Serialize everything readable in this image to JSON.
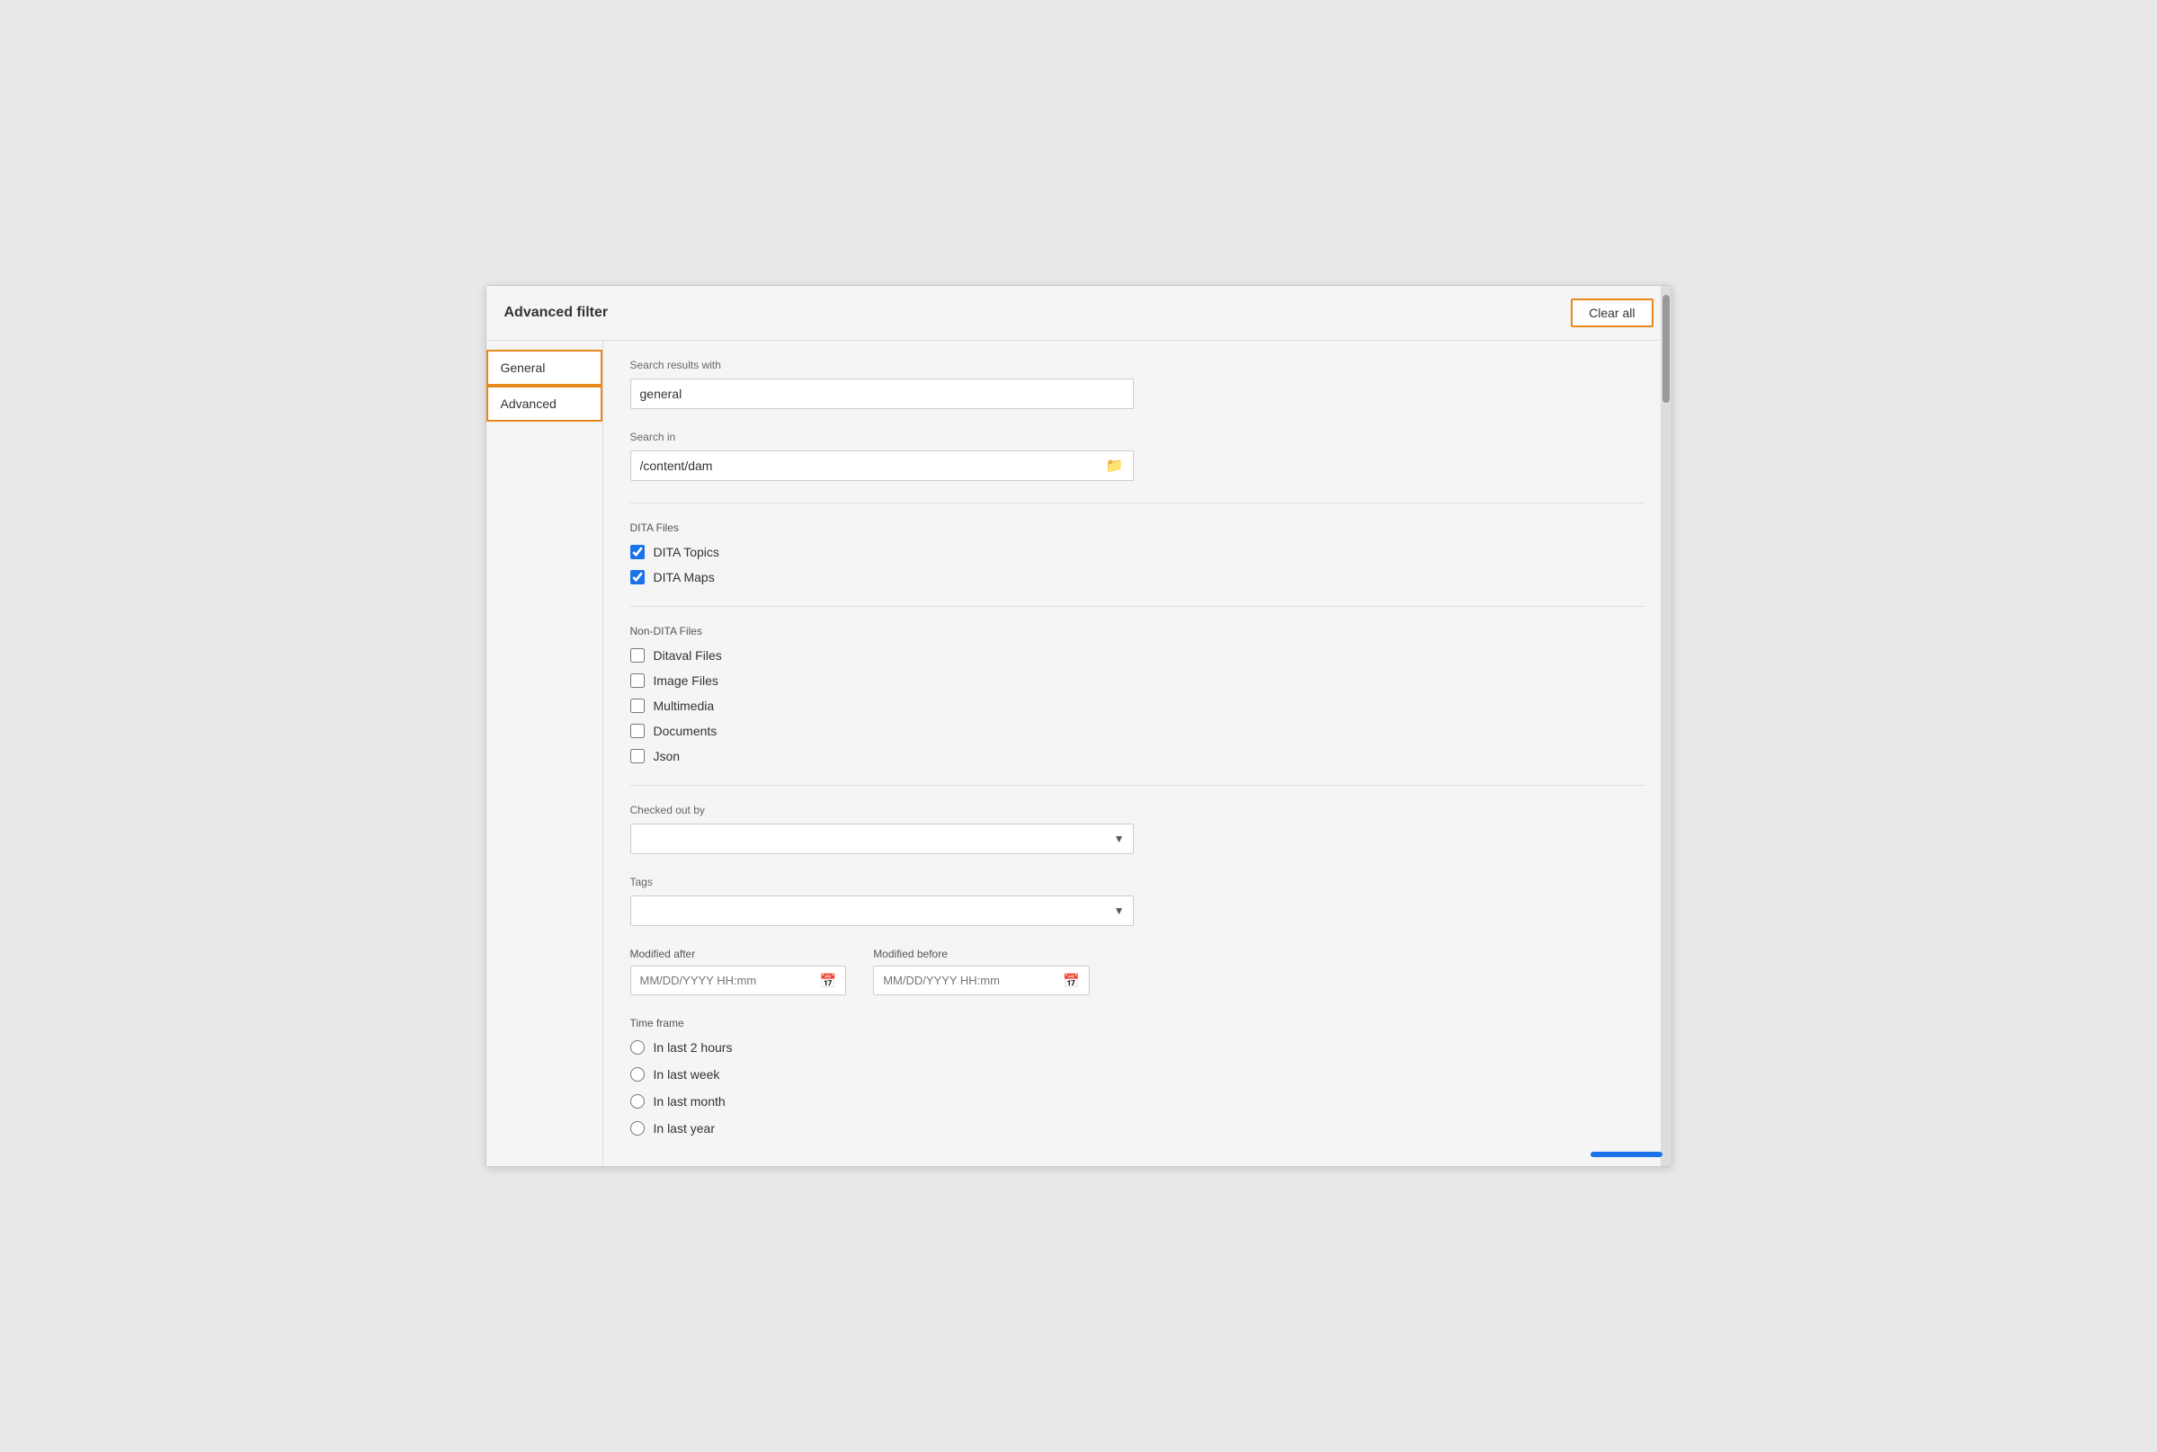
{
  "dialog": {
    "title": "Advanced filter",
    "clearAll": "Clear all"
  },
  "sidebar": {
    "items": [
      {
        "id": "general",
        "label": "General",
        "active": true
      },
      {
        "id": "advanced",
        "label": "Advanced",
        "active": true
      }
    ]
  },
  "general": {
    "searchResultsWith": {
      "label": "Search results with",
      "value": "general",
      "placeholder": ""
    },
    "searchIn": {
      "label": "Search in",
      "value": "/content/dam",
      "placeholder": ""
    }
  },
  "ditaFiles": {
    "label": "DITA Files",
    "items": [
      {
        "id": "dita-topics",
        "label": "DITA Topics",
        "checked": true
      },
      {
        "id": "dita-maps",
        "label": "DITA Maps",
        "checked": true
      }
    ]
  },
  "nonDitaFiles": {
    "label": "Non-DITA Files",
    "items": [
      {
        "id": "ditaval",
        "label": "Ditaval Files",
        "checked": false
      },
      {
        "id": "image",
        "label": "Image Files",
        "checked": false
      },
      {
        "id": "multimedia",
        "label": "Multimedia",
        "checked": false
      },
      {
        "id": "documents",
        "label": "Documents",
        "checked": false
      },
      {
        "id": "json",
        "label": "Json",
        "checked": false
      }
    ]
  },
  "checkedOutBy": {
    "label": "Checked out by",
    "placeholder": "",
    "options": []
  },
  "tags": {
    "label": "Tags",
    "placeholder": "",
    "options": []
  },
  "modifiedAfter": {
    "label": "Modified after",
    "placeholder": "MM/DD/YYYY HH:mm"
  },
  "modifiedBefore": {
    "label": "Modified before",
    "placeholder": "MM/DD/YYYY HH:mm"
  },
  "timeFrame": {
    "label": "Time frame",
    "options": [
      {
        "id": "last2hours",
        "label": "In last 2 hours",
        "selected": false
      },
      {
        "id": "lastweek",
        "label": "In last week",
        "selected": false
      },
      {
        "id": "lastmonth",
        "label": "In last month",
        "selected": false
      },
      {
        "id": "lastyear",
        "label": "In last year",
        "selected": false
      }
    ]
  },
  "icons": {
    "folder": "🗂",
    "calendar": "📅",
    "chevronDown": "▾"
  }
}
